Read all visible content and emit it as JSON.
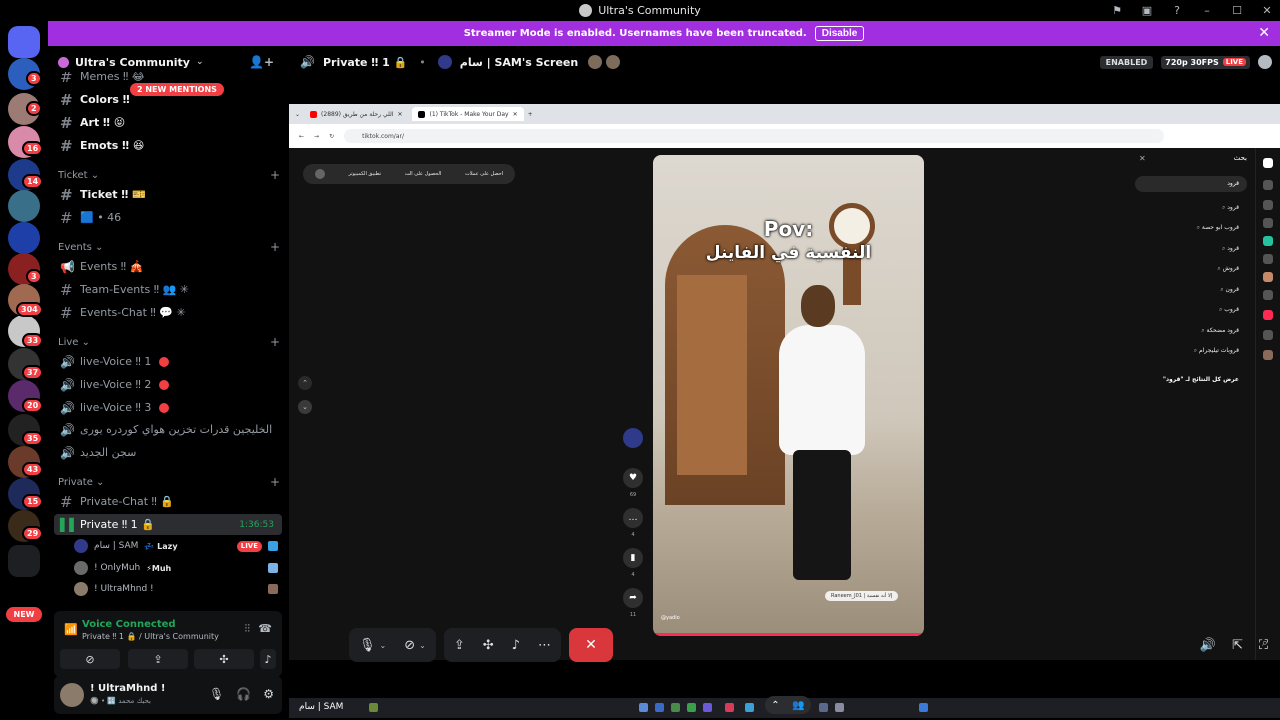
{
  "titlebar": {
    "title": "Ultra's Community"
  },
  "banner": {
    "message": "Streamer Mode is enabled. Usernames have been truncated.",
    "disable_label": "Disable"
  },
  "rail_badges": [
    "3",
    "2",
    "16",
    "14",
    "3",
    "304",
    "33",
    "37",
    "20",
    "35",
    "43",
    "15",
    "29"
  ],
  "rail_new": "NEW",
  "guild": {
    "name": "Ultra's Community"
  },
  "mentions_pill": "2 NEW MENTIONS",
  "channels": {
    "memes": "Memes ‼ 😂",
    "colors": "Colors ‼",
    "art": "Art ‼ 😝",
    "emots": "Emots ‼ 😆",
    "cat_ticket": "Ticket",
    "ticket": "Ticket ‼ 🎫",
    "ticket2": "🟦 • 46",
    "cat_events": "Events",
    "events": "Events ‼ 🎪",
    "team_events": "Team-Events ‼ 👥 ✳",
    "events_chat": "Events-Chat ‼ 💬 ✳",
    "cat_live": "Live",
    "live1": "live-Voice ‼ 1",
    "live2": "live-Voice ‼ 2",
    "live3": "live-Voice ‼ 3",
    "arabic1": "الخليجين قدرات تخزين هواي كوردره يورى",
    "arabic2": "سجن الجديد",
    "cat_private": "Private",
    "private_chat": "Private-Chat ‼ 🔒",
    "private_voice": "Private ‼ 1 🔒",
    "private_timer": "1:36:53"
  },
  "voice_users": [
    {
      "name": "سام | SAM",
      "tag": "💤 Lazy",
      "live": "LIVE"
    },
    {
      "name": "! OnlyMuh",
      "tag": "⚡Muh"
    },
    {
      "name": "! UltraMhnd !",
      "tag": ""
    },
    {
      "name": "",
      "tag": ""
    }
  ],
  "voice_panel": {
    "status": "Voice Connected",
    "channel": "Private ‼ 1 🔒 / Ultra's Community"
  },
  "user_panel": {
    "name": "! UltraMhnd !",
    "status": "🔘 • 🔣 بحبك محمد"
  },
  "stream_header": {
    "channel": "Private ‼ 1 🔒",
    "screen": "سام | SAM's Screen",
    "enabled": "ENABLED",
    "quality": "720p 30FPS",
    "live": "LIVE"
  },
  "browser": {
    "tab1": "(2889) اللي رحلة من طريق",
    "tab2": "(1) TikTok - Make Your Day",
    "url": "tiktok.com/ar/"
  },
  "tiktok": {
    "pills": [
      "احصل على عملات",
      "الحصول على الت",
      "تطبيق الكمبيوتر"
    ],
    "pov_line1": "Pov:",
    "pov_line2": "النفسية في الفاينل",
    "creator": "Raneem_J01 | إلا أنه نفسية",
    "handle": "@yadio",
    "likes": "69",
    "comments": "4",
    "saves": "4",
    "shares": "11",
    "search_title": "بحث",
    "search_value": "قرود",
    "suggestions": [
      "قرود",
      "قروب ابو حصة",
      "قرود",
      "قروش",
      "قرون",
      "قروب",
      "قرود مضحكة",
      "قروبات تيليجرام"
    ],
    "see_all": "عرض كل النتائج لـ \"قرود\""
  },
  "taskbar": {
    "label": "سام | SAM"
  }
}
